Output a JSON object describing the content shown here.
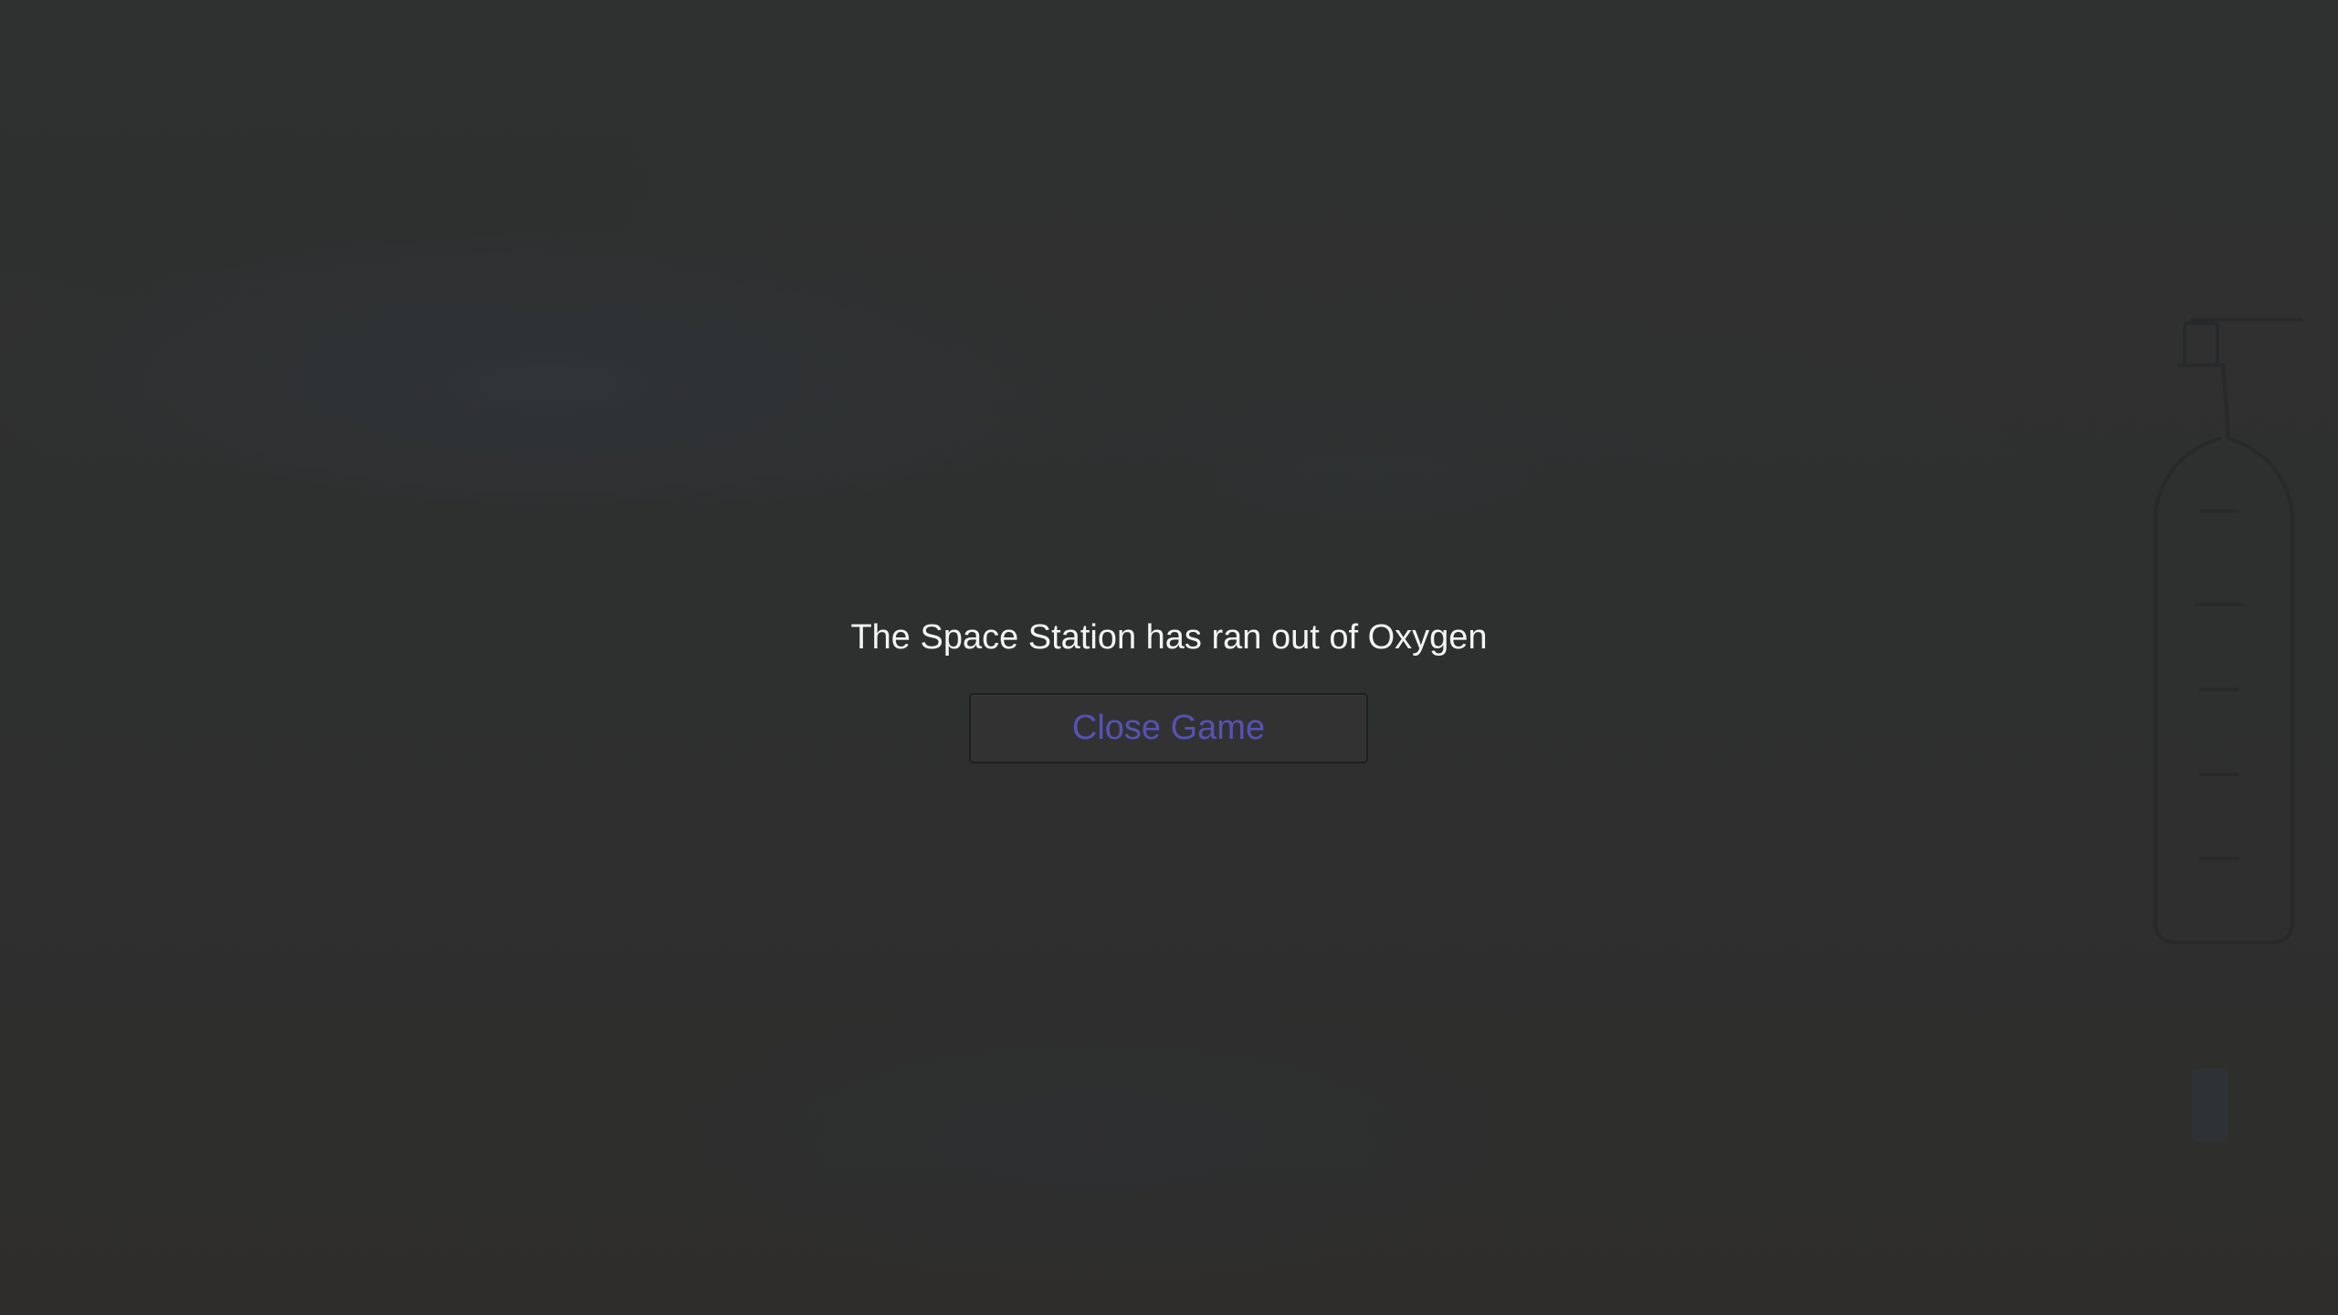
{
  "game_over": {
    "message": "The Space Station has ran out of Oxygen",
    "close_button_label": "Close Game"
  },
  "background": {
    "oxygen_tank": "oxygen-tank-icon"
  },
  "colors": {
    "background": "#313231",
    "message_text": "#f4f4f4",
    "button_text": "#5652b6",
    "button_border": "#1f1f20",
    "button_background": "#323233"
  }
}
